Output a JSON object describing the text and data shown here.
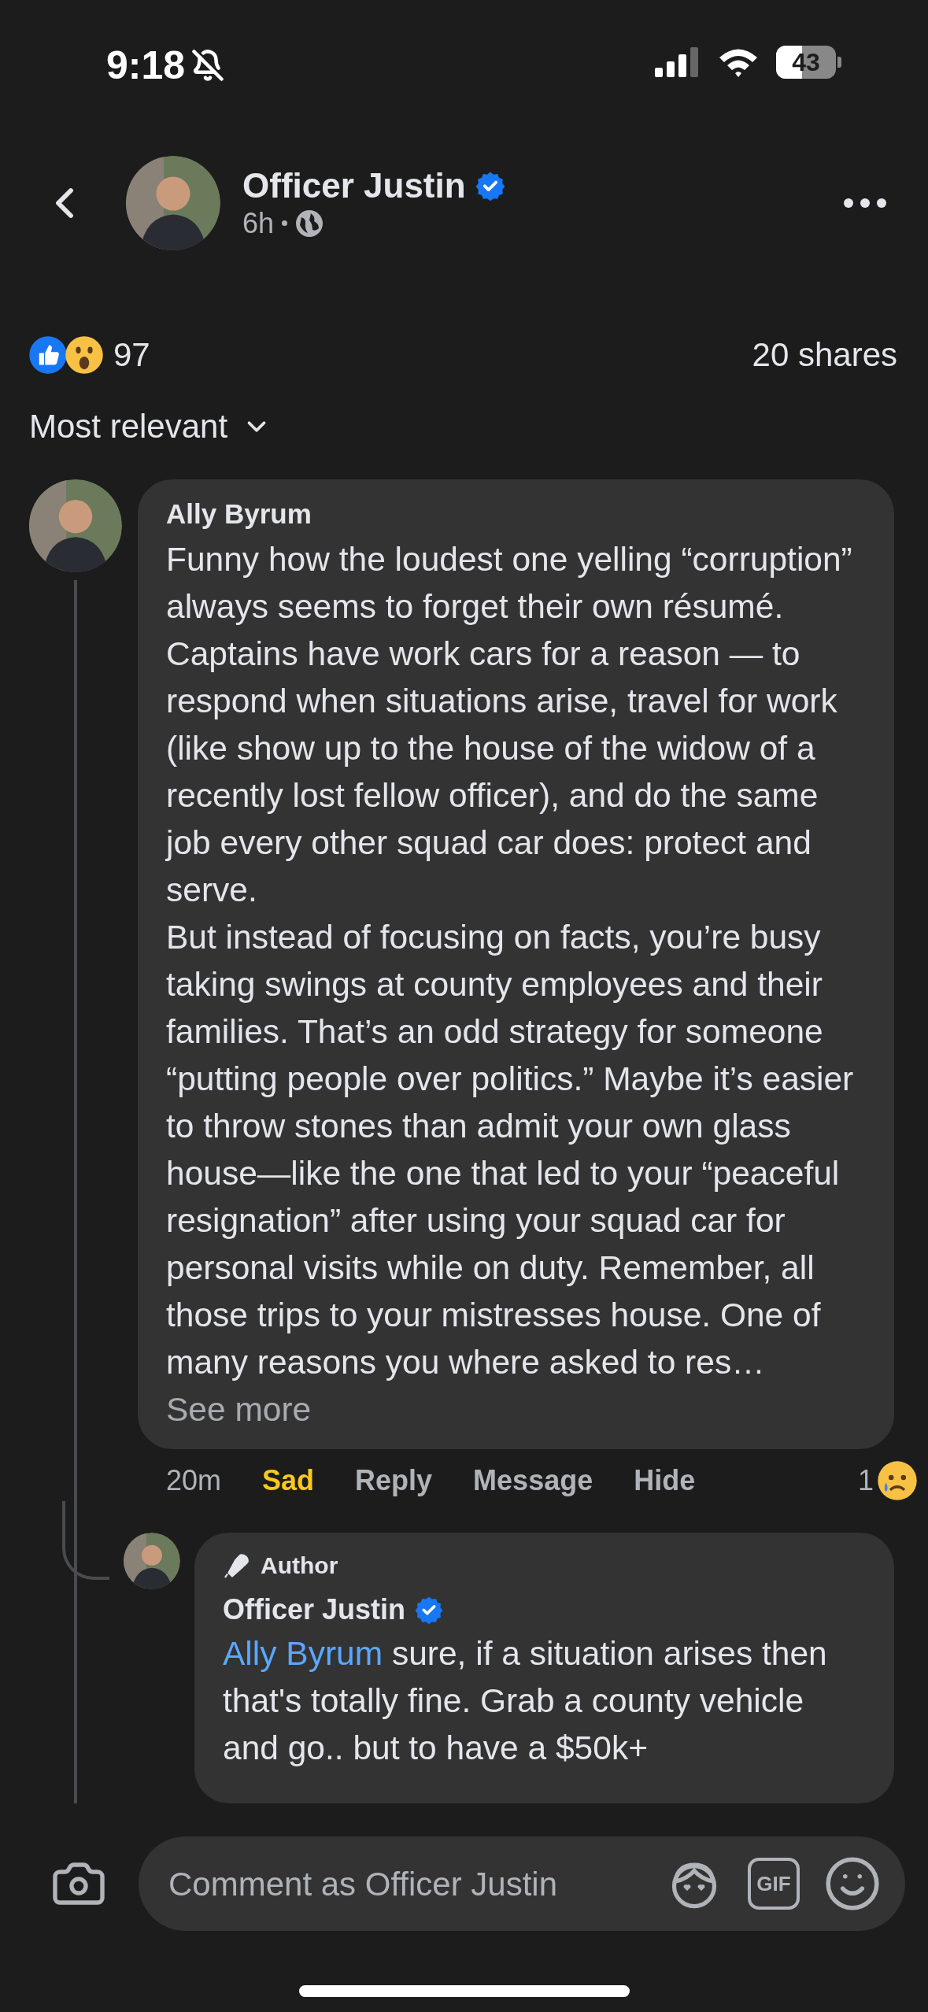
{
  "status_bar": {
    "time": "9:18",
    "battery": "43"
  },
  "post_header": {
    "author": "Officer Justin",
    "verified": true,
    "time": "6h"
  },
  "reactions": {
    "count": "97",
    "shares": "20 shares"
  },
  "sort": {
    "label": "Most relevant"
  },
  "comments": [
    {
      "author": "Ally Byrum",
      "paragraphs": [
        "Funny how the loudest one yelling “corruption” always seems to forget their own résumé. Captains have work cars for a reason — to respond when situations arise, travel for work (like show up to the house of the widow of a recently lost fellow officer), and do the same job every other squad car does: protect and serve.",
        "But instead of focusing on facts, you’re busy taking swings at county employees and their families. That’s an odd strategy for someone “putting people over politics.” Maybe it’s easier to throw stones than admit your own glass house—like the one that led to your “peaceful resignation” after using your squad car for personal visits while on duty. Remember, all those trips to your mistresses house. One of many reasons you where asked to res…"
      ],
      "see_more": "See more",
      "time": "20m",
      "reaction_label": "Sad",
      "reacted": true,
      "actions": [
        "Reply",
        "Message",
        "Hide"
      ],
      "reaction_count": "1",
      "replies": [
        {
          "badge": "Author",
          "author": "Officer Justin",
          "verified": true,
          "mention": "Ally Byrum",
          "text": "sure, if a situation arises then that's totally fine. Grab a county vehicle and go.. but to have a $50k+"
        }
      ]
    }
  ],
  "composer": {
    "placeholder": "Comment as Officer Justin",
    "gif": "GIF"
  }
}
